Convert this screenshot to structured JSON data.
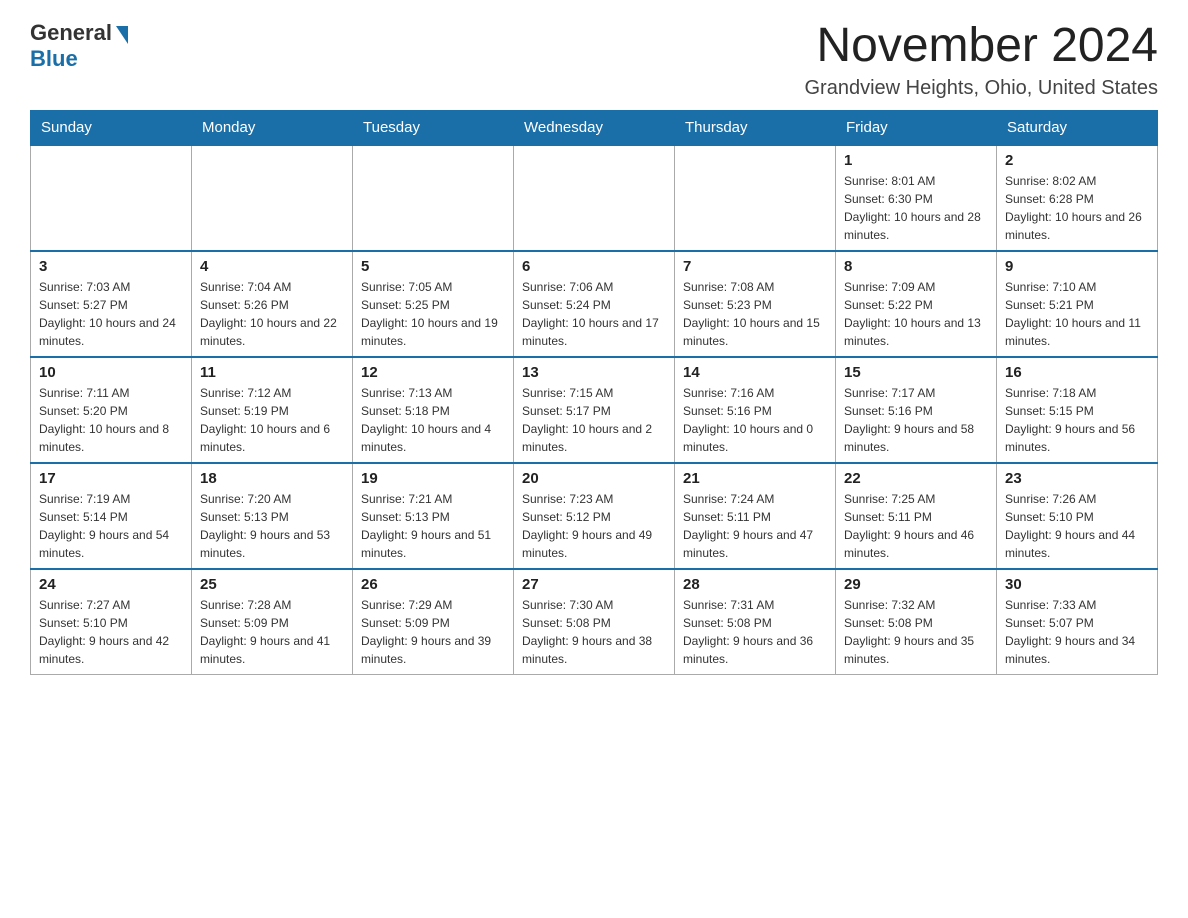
{
  "header": {
    "logo_general": "General",
    "logo_blue": "Blue",
    "month_title": "November 2024",
    "location": "Grandview Heights, Ohio, United States"
  },
  "days_of_week": [
    "Sunday",
    "Monday",
    "Tuesday",
    "Wednesday",
    "Thursday",
    "Friday",
    "Saturday"
  ],
  "weeks": [
    [
      {
        "day": "",
        "info": ""
      },
      {
        "day": "",
        "info": ""
      },
      {
        "day": "",
        "info": ""
      },
      {
        "day": "",
        "info": ""
      },
      {
        "day": "",
        "info": ""
      },
      {
        "day": "1",
        "info": "Sunrise: 8:01 AM\nSunset: 6:30 PM\nDaylight: 10 hours and 28 minutes."
      },
      {
        "day": "2",
        "info": "Sunrise: 8:02 AM\nSunset: 6:28 PM\nDaylight: 10 hours and 26 minutes."
      }
    ],
    [
      {
        "day": "3",
        "info": "Sunrise: 7:03 AM\nSunset: 5:27 PM\nDaylight: 10 hours and 24 minutes."
      },
      {
        "day": "4",
        "info": "Sunrise: 7:04 AM\nSunset: 5:26 PM\nDaylight: 10 hours and 22 minutes."
      },
      {
        "day": "5",
        "info": "Sunrise: 7:05 AM\nSunset: 5:25 PM\nDaylight: 10 hours and 19 minutes."
      },
      {
        "day": "6",
        "info": "Sunrise: 7:06 AM\nSunset: 5:24 PM\nDaylight: 10 hours and 17 minutes."
      },
      {
        "day": "7",
        "info": "Sunrise: 7:08 AM\nSunset: 5:23 PM\nDaylight: 10 hours and 15 minutes."
      },
      {
        "day": "8",
        "info": "Sunrise: 7:09 AM\nSunset: 5:22 PM\nDaylight: 10 hours and 13 minutes."
      },
      {
        "day": "9",
        "info": "Sunrise: 7:10 AM\nSunset: 5:21 PM\nDaylight: 10 hours and 11 minutes."
      }
    ],
    [
      {
        "day": "10",
        "info": "Sunrise: 7:11 AM\nSunset: 5:20 PM\nDaylight: 10 hours and 8 minutes."
      },
      {
        "day": "11",
        "info": "Sunrise: 7:12 AM\nSunset: 5:19 PM\nDaylight: 10 hours and 6 minutes."
      },
      {
        "day": "12",
        "info": "Sunrise: 7:13 AM\nSunset: 5:18 PM\nDaylight: 10 hours and 4 minutes."
      },
      {
        "day": "13",
        "info": "Sunrise: 7:15 AM\nSunset: 5:17 PM\nDaylight: 10 hours and 2 minutes."
      },
      {
        "day": "14",
        "info": "Sunrise: 7:16 AM\nSunset: 5:16 PM\nDaylight: 10 hours and 0 minutes."
      },
      {
        "day": "15",
        "info": "Sunrise: 7:17 AM\nSunset: 5:16 PM\nDaylight: 9 hours and 58 minutes."
      },
      {
        "day": "16",
        "info": "Sunrise: 7:18 AM\nSunset: 5:15 PM\nDaylight: 9 hours and 56 minutes."
      }
    ],
    [
      {
        "day": "17",
        "info": "Sunrise: 7:19 AM\nSunset: 5:14 PM\nDaylight: 9 hours and 54 minutes."
      },
      {
        "day": "18",
        "info": "Sunrise: 7:20 AM\nSunset: 5:13 PM\nDaylight: 9 hours and 53 minutes."
      },
      {
        "day": "19",
        "info": "Sunrise: 7:21 AM\nSunset: 5:13 PM\nDaylight: 9 hours and 51 minutes."
      },
      {
        "day": "20",
        "info": "Sunrise: 7:23 AM\nSunset: 5:12 PM\nDaylight: 9 hours and 49 minutes."
      },
      {
        "day": "21",
        "info": "Sunrise: 7:24 AM\nSunset: 5:11 PM\nDaylight: 9 hours and 47 minutes."
      },
      {
        "day": "22",
        "info": "Sunrise: 7:25 AM\nSunset: 5:11 PM\nDaylight: 9 hours and 46 minutes."
      },
      {
        "day": "23",
        "info": "Sunrise: 7:26 AM\nSunset: 5:10 PM\nDaylight: 9 hours and 44 minutes."
      }
    ],
    [
      {
        "day": "24",
        "info": "Sunrise: 7:27 AM\nSunset: 5:10 PM\nDaylight: 9 hours and 42 minutes."
      },
      {
        "day": "25",
        "info": "Sunrise: 7:28 AM\nSunset: 5:09 PM\nDaylight: 9 hours and 41 minutes."
      },
      {
        "day": "26",
        "info": "Sunrise: 7:29 AM\nSunset: 5:09 PM\nDaylight: 9 hours and 39 minutes."
      },
      {
        "day": "27",
        "info": "Sunrise: 7:30 AM\nSunset: 5:08 PM\nDaylight: 9 hours and 38 minutes."
      },
      {
        "day": "28",
        "info": "Sunrise: 7:31 AM\nSunset: 5:08 PM\nDaylight: 9 hours and 36 minutes."
      },
      {
        "day": "29",
        "info": "Sunrise: 7:32 AM\nSunset: 5:08 PM\nDaylight: 9 hours and 35 minutes."
      },
      {
        "day": "30",
        "info": "Sunrise: 7:33 AM\nSunset: 5:07 PM\nDaylight: 9 hours and 34 minutes."
      }
    ]
  ]
}
